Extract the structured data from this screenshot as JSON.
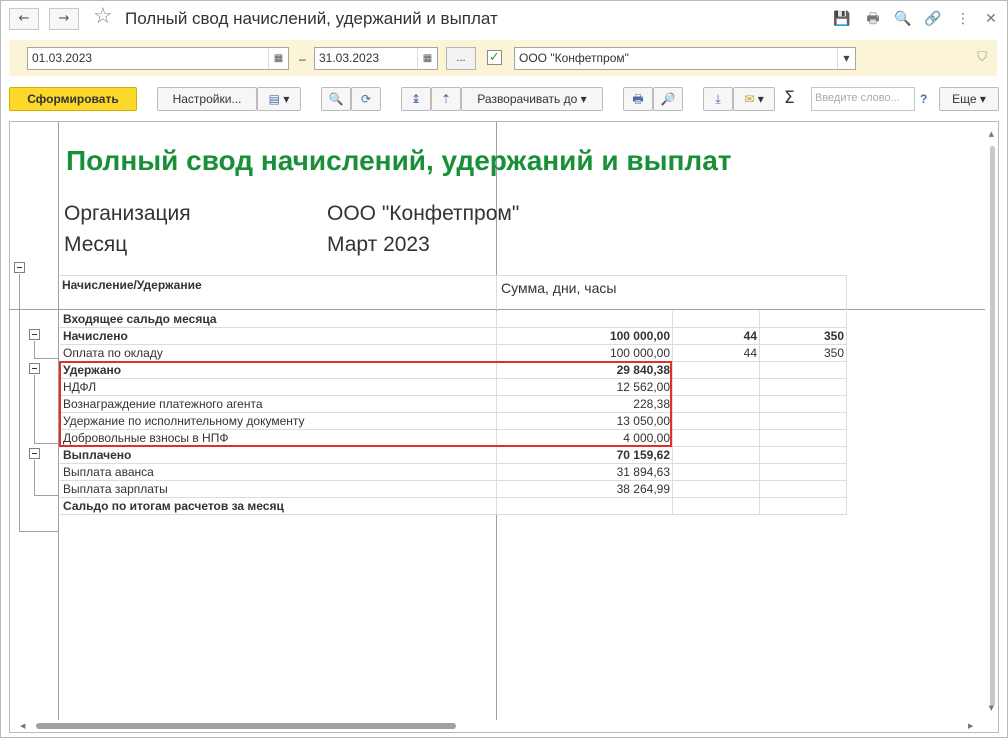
{
  "window": {
    "title": "Полный свод начислений, удержаний и выплат",
    "back_icon": "←",
    "forward_icon": "→",
    "star_icon": "☆",
    "actions": [
      "save-icon",
      "print-icon",
      "preview-icon",
      "link-icon",
      "more-icon",
      "close-icon"
    ],
    "action_glyphs": [
      "💾",
      "🖶",
      "🔍",
      "🔗",
      "⋮",
      "✕"
    ]
  },
  "filter": {
    "date_from": "01.03.2023",
    "date_to": "31.03.2023",
    "dash": "–",
    "dots_label": "...",
    "org_checked": true,
    "check_glyph": "✓",
    "organization": "ООО \"Конфетпром\"",
    "dropdown_glyph": "▼",
    "filter_glyph": "⛉",
    "calendar_glyph": "▦"
  },
  "toolbar": {
    "generate_label": "Сформировать",
    "settings_label": "Настройки...",
    "expand_label": "Разворачивать до",
    "search_placeholder": "Введите слово...",
    "help_label": "?",
    "more_label": "Еще",
    "sigma": "Σ",
    "caret": "▾"
  },
  "report": {
    "title": "Полный свод начислений, удержаний и выплат",
    "params": [
      {
        "label": "Организация",
        "value": "ООО \"Конфетпром\""
      },
      {
        "label": "Месяц",
        "value": "Март 2023"
      }
    ],
    "header": {
      "col1": "Начисление/Удержание",
      "col2": "Сумма, дни, часы"
    },
    "rows": [
      {
        "name": "Входящее сальдо месяца",
        "sum": "",
        "days": "",
        "hours": "",
        "bold": true
      },
      {
        "name": "Начислено",
        "sum": "100 000,00",
        "days": "44",
        "hours": "350",
        "bold": true
      },
      {
        "name": "Оплата по окладу",
        "sum": "100 000,00",
        "days": "44",
        "hours": "350",
        "bold": false
      },
      {
        "name": "Удержано",
        "sum": "29 840,38",
        "days": "",
        "hours": "",
        "bold": true
      },
      {
        "name": "НДФЛ",
        "sum": "12 562,00",
        "days": "",
        "hours": "",
        "bold": false
      },
      {
        "name": "Вознаграждение платежного агента",
        "sum": "228,38",
        "days": "",
        "hours": "",
        "bold": false
      },
      {
        "name": "Удержание по исполнительному документу",
        "sum": "13 050,00",
        "days": "",
        "hours": "",
        "bold": false
      },
      {
        "name": "Добровольные взносы в НПФ",
        "sum": "4 000,00",
        "days": "",
        "hours": "",
        "bold": false
      },
      {
        "name": "Выплачено",
        "sum": "70 159,62",
        "days": "",
        "hours": "",
        "bold": true
      },
      {
        "name": "Выплата аванса",
        "sum": "31 894,63",
        "days": "",
        "hours": "",
        "bold": false
      },
      {
        "name": "Выплата зарплаты",
        "sum": "38 264,99",
        "days": "",
        "hours": "",
        "bold": false
      },
      {
        "name": "Сальдо по итогам расчетов за месяц",
        "sum": "",
        "days": "",
        "hours": "",
        "bold": true
      }
    ]
  },
  "colors": {
    "title_green": "#1a8f3a",
    "highlight_red": "#e0302a",
    "primary_yellow": "#fbd82a",
    "filter_bg": "#fbf4d6"
  }
}
